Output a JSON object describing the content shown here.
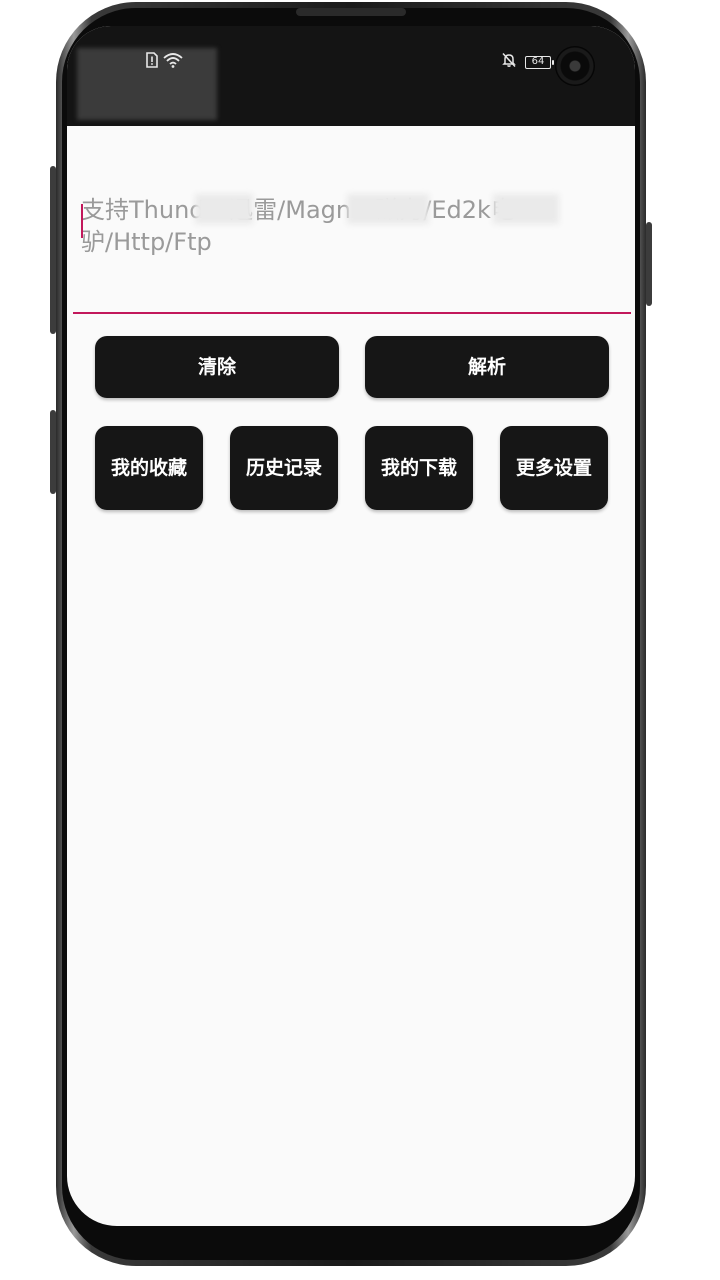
{
  "status_bar": {
    "battery_level": "64",
    "icons": [
      "sim-alert-icon",
      "wifi-icon",
      "bell-off-icon",
      "battery-icon"
    ]
  },
  "input": {
    "placeholder": "支持Thunder迅雷/Magnet磁力/Ed2k电驴/Http/Ftp",
    "value": ""
  },
  "buttons": {
    "clear_label": "清除",
    "parse_label": "解析",
    "favorites_label": "我的收藏",
    "history_label": "历史记录",
    "downloads_label": "我的下载",
    "settings_label": "更多设置"
  },
  "colors": {
    "accent": "#c2185b",
    "button_bg": "#161616",
    "screen_bg": "#fafafa",
    "status_bg": "#141414"
  }
}
